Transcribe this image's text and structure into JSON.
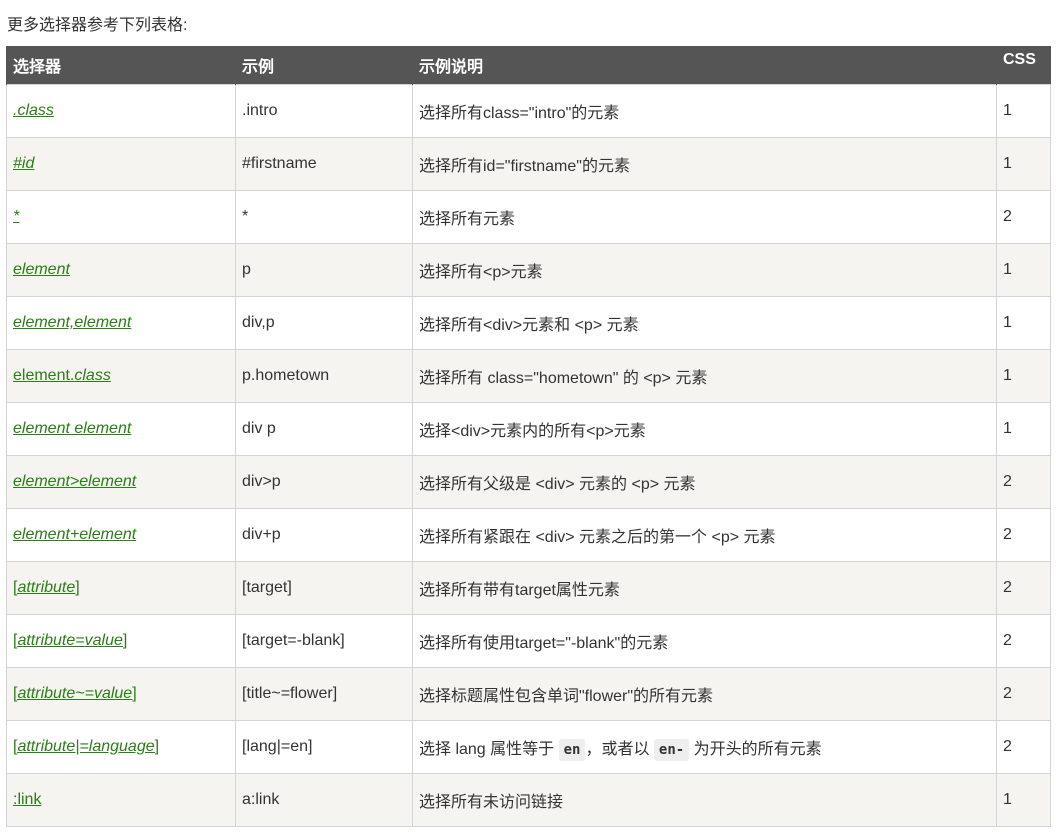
{
  "intro": "更多选择器参考下列表格:",
  "headers": {
    "selector": "选择器",
    "example": "示例",
    "description": "示例说明",
    "css": "CSS"
  },
  "rows": [
    {
      "sel": [
        {
          "t": ".class",
          "i": true
        }
      ],
      "example": ".intro",
      "desc": [
        {
          "t": "选择所有class=\"intro\"的元素"
        }
      ],
      "css": "1"
    },
    {
      "sel": [
        {
          "t": "#id",
          "i": true
        }
      ],
      "example": "#firstname",
      "desc": [
        {
          "t": "选择所有id=\"firstname\"的元素"
        }
      ],
      "css": "1"
    },
    {
      "sel": [
        {
          "t": "*",
          "i": true
        }
      ],
      "example": "*",
      "desc": [
        {
          "t": "选择所有元素"
        }
      ],
      "css": "2"
    },
    {
      "sel": [
        {
          "t": "element",
          "i": true
        }
      ],
      "example": "p",
      "desc": [
        {
          "t": "选择所有<p>元素"
        }
      ],
      "css": "1"
    },
    {
      "sel": [
        {
          "t": "element,element",
          "i": true
        }
      ],
      "example": "div,p",
      "desc": [
        {
          "t": "选择所有<div>元素和 <p> 元素"
        }
      ],
      "css": "1"
    },
    {
      "sel": [
        {
          "t": "element.",
          "i": false
        },
        {
          "t": "class",
          "i": true
        }
      ],
      "example": "p.hometown",
      "desc": [
        {
          "t": "选择所有 class=\"hometown\" 的 <p> 元素"
        }
      ],
      "css": "1"
    },
    {
      "sel": [
        {
          "t": "element element",
          "i": true
        }
      ],
      "example": "div p",
      "desc": [
        {
          "t": "选择<div>元素内的所有<p>元素"
        }
      ],
      "css": "1"
    },
    {
      "sel": [
        {
          "t": "element>element",
          "i": true
        }
      ],
      "example": "div>p",
      "desc": [
        {
          "t": "选择所有父级是 <div> 元素的 <p> 元素"
        }
      ],
      "css": "2"
    },
    {
      "sel": [
        {
          "t": "element+element",
          "i": true
        }
      ],
      "example": "div+p",
      "desc": [
        {
          "t": "选择所有紧跟在 <div> 元素之后的第一个 <p> 元素"
        }
      ],
      "css": "2"
    },
    {
      "sel": [
        {
          "t": "[",
          "i": false
        },
        {
          "t": "attribute",
          "i": true
        },
        {
          "t": "]",
          "i": false
        }
      ],
      "example": "[target]",
      "desc": [
        {
          "t": "选择所有带有target属性元素"
        }
      ],
      "css": "2"
    },
    {
      "sel": [
        {
          "t": "[",
          "i": false
        },
        {
          "t": "attribute=value",
          "i": true
        },
        {
          "t": "]",
          "i": false
        }
      ],
      "example": "[target=-blank]",
      "desc": [
        {
          "t": "选择所有使用target=\"-blank\"的元素"
        }
      ],
      "css": "2"
    },
    {
      "sel": [
        {
          "t": "[",
          "i": false
        },
        {
          "t": "attribute~=value",
          "i": true
        },
        {
          "t": "]",
          "i": false
        }
      ],
      "example": "[title~=flower]",
      "desc": [
        {
          "t": "选择标题属性包含单词\"flower\"的所有元素"
        }
      ],
      "css": "2"
    },
    {
      "sel": [
        {
          "t": "[",
          "i": false
        },
        {
          "t": "attribute|=language",
          "i": true
        },
        {
          "t": "]",
          "i": false
        }
      ],
      "example": "[lang|=en]",
      "desc": [
        {
          "t": "选择 lang 属性等于 "
        },
        {
          "t": "en",
          "code": true
        },
        {
          "t": "，或者以 "
        },
        {
          "t": "en-",
          "code": true
        },
        {
          "t": " 为开头的所有元素"
        }
      ],
      "css": "2"
    },
    {
      "sel": [
        {
          "t": ":link",
          "i": false
        }
      ],
      "example": "a:link",
      "desc": [
        {
          "t": "选择所有未访问链接"
        }
      ],
      "css": "1"
    }
  ]
}
